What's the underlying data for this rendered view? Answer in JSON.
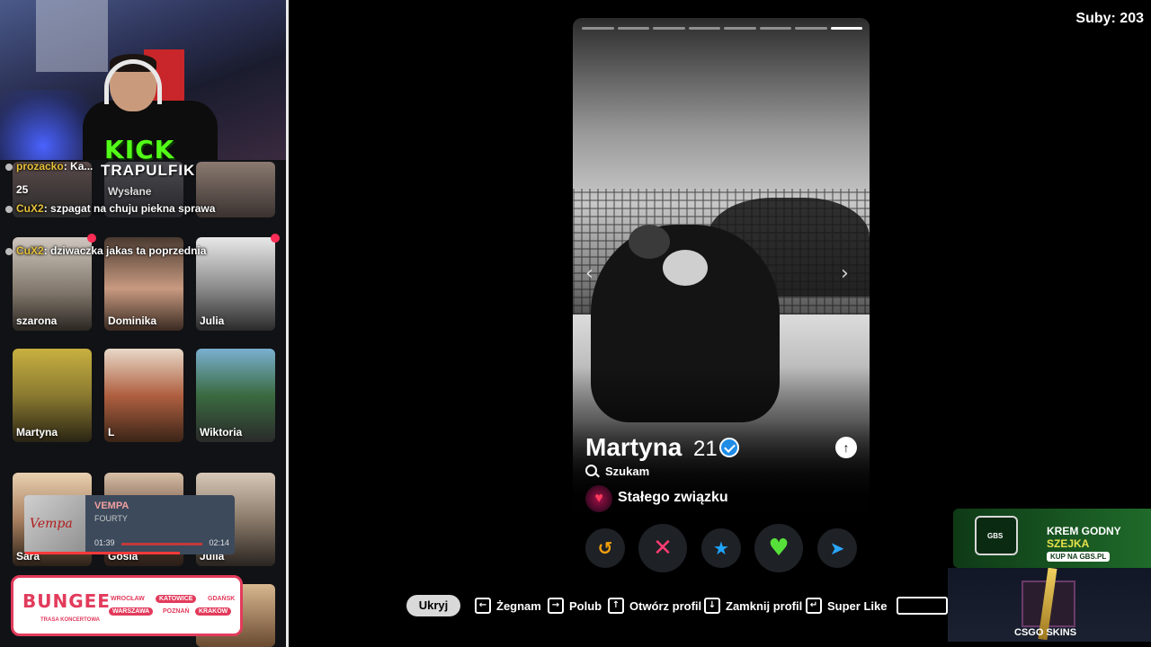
{
  "stream": {
    "platform_logo": "KICK",
    "streamer_name": "TRAPULFIK",
    "subs_counter": "Suby: 203"
  },
  "sidebar": {
    "overlay_top": {
      "partial_name": "25",
      "sent_label": "Wysłane"
    },
    "chat": [
      {
        "user": "prozacko",
        "text": "Ka..."
      },
      {
        "user": "CuX2",
        "text": "szpagat na chuju piekna sprawa"
      },
      {
        "user": "CuX2",
        "text": "dziwaczka jakas ta poprzednia"
      }
    ],
    "profiles": [
      {
        "name": "szarona"
      },
      {
        "name": "Dominika"
      },
      {
        "name": "Julia"
      },
      {
        "name": "Martyna"
      },
      {
        "name": "L"
      },
      {
        "name": "Wiktoria"
      },
      {
        "name": "Sara"
      },
      {
        "name": "Gosia"
      },
      {
        "name": "Julia"
      }
    ]
  },
  "music_widget": {
    "cover_text": "Vempa",
    "title": "VEMPA",
    "artist": "FOURTY",
    "elapsed": "01:39",
    "duration": "02:14",
    "progress": 0.74
  },
  "bungee_ad": {
    "logo": "BUNGEE",
    "subtitle": "TRASA KONCERTOWA",
    "cities": [
      "WROCŁAW",
      "KATOWICE",
      "GDAŃSK",
      "WARSZAWA",
      "POZNAŃ",
      "KRAKÓW"
    ]
  },
  "card": {
    "story_segments": 8,
    "active_segment": 8,
    "name": "Martyna",
    "age": "21",
    "verified": true,
    "looking_label": "Szukam",
    "relationship_label": "Stałego związku",
    "nav_prev": "‹",
    "nav_next": "›",
    "up_arrow": "↑"
  },
  "actions": [
    {
      "name": "rewind-button",
      "icon": "rewind-icon",
      "glyph": "↺",
      "color": "#f2a10c"
    },
    {
      "name": "nope-button",
      "icon": "x-icon",
      "glyph": "✕",
      "color": "#fe3c72"
    },
    {
      "name": "super-like-button",
      "icon": "star-icon",
      "glyph": "★",
      "color": "#1fa5ff"
    },
    {
      "name": "like-button",
      "icon": "heart-icon",
      "glyph": "♥",
      "color": "#57e03a"
    },
    {
      "name": "boost-button",
      "icon": "send-icon",
      "glyph": "➤",
      "color": "#2aa6ff"
    }
  ],
  "bottom_bar": {
    "hide_label": "Ukryj",
    "hints": [
      {
        "key": "←",
        "label": "Żegnam"
      },
      {
        "key": "→",
        "label": "Polub"
      },
      {
        "key": "↑",
        "label": "Otwórz profil"
      },
      {
        "key": "↓",
        "label": "Zamknij profil"
      },
      {
        "key": "↵",
        "label": "Super Like"
      }
    ]
  },
  "ads": {
    "krem_line1": "KREM GODNY",
    "krem_line2": "SZEJKA",
    "krem_cta": "KUP NA GBS.PL",
    "krem_brand": "GBS",
    "csgo_label": "CSGO SKINS"
  },
  "colors": {
    "accent_pink": "#ff2d55",
    "verified_blue": "#1f8ce6",
    "kick_green": "#53fc18"
  }
}
